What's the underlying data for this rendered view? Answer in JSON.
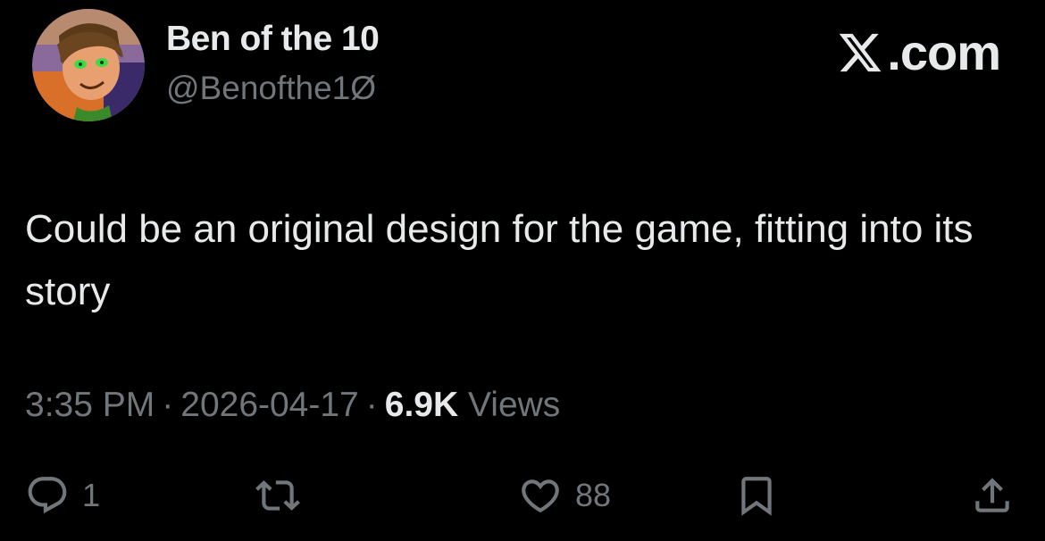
{
  "brand": {
    "label": ".com",
    "icon": "x-logo-icon"
  },
  "author": {
    "display_name": "Ben of the 10",
    "handle": "@Benofthe1Ø"
  },
  "tweet": {
    "text": "Could be an original design for the game, fitting into its story"
  },
  "meta": {
    "time": "3:35 PM",
    "separator": "·",
    "date": "2026-04-17",
    "views_count": "6.9K",
    "views_label": "Views"
  },
  "actions": {
    "reply": {
      "icon": "reply-icon",
      "count": "1"
    },
    "retweet": {
      "icon": "retweet-icon",
      "count": ""
    },
    "like": {
      "icon": "heart-icon",
      "count": "88"
    },
    "bookmark": {
      "icon": "bookmark-icon"
    },
    "share": {
      "icon": "share-icon"
    }
  },
  "colors": {
    "background": "#000000",
    "primary_text": "#e7e9ea",
    "secondary_text": "#71767b"
  }
}
